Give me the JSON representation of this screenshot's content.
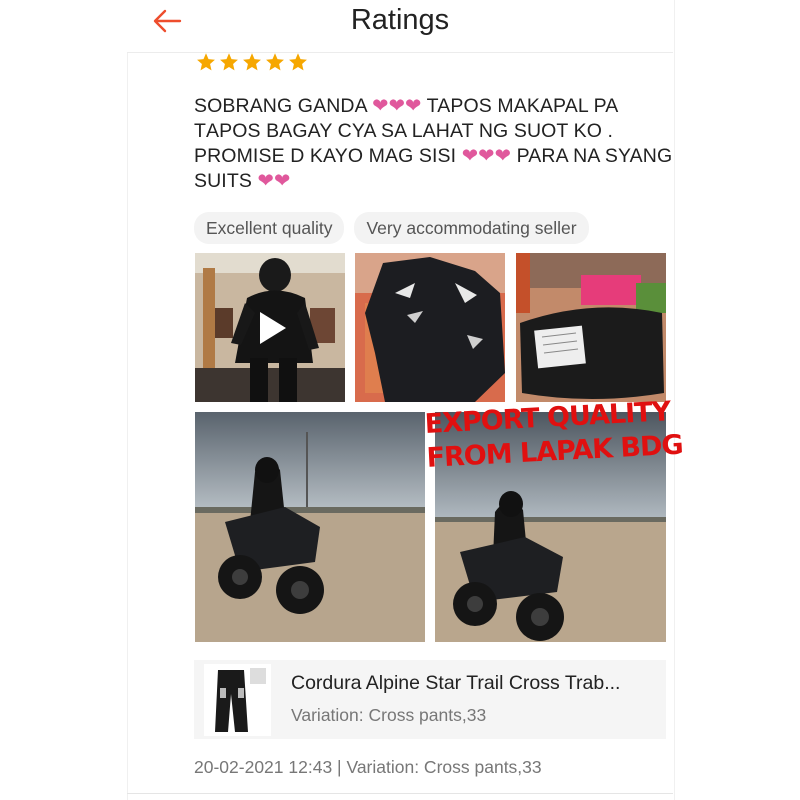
{
  "header": {
    "title": "Ratings",
    "back_icon": "arrow-left-icon",
    "accent": "#ee4d2d"
  },
  "rating": {
    "stars": 5,
    "star_color": "#f6a700"
  },
  "review": {
    "text": "SOBRANG GANDA ❤❤❤ TAPOS MAKAPAL PA TAPOS BAGAY CYA SA LAHAT NG SUOT KO . PROMISE D KAYO MAG SISI ❤❤❤ PARA NA SYANG SUITS ❤❤",
    "heart_color": "#e0589c"
  },
  "tags": [
    "Excellent quality",
    "Very accommodating seller"
  ],
  "media": {
    "video_icon": "play-icon",
    "overlay_text_line1": "EXPORT QUALITY",
    "overlay_text_line2": "FROM LAPAK BDG"
  },
  "product": {
    "name": "Cordura Alpine Star Trail Cross Trab...",
    "variation": "Variation: Cross pants,33"
  },
  "footer": {
    "meta": "20-02-2021 12:43 | Variation: Cross pants,33"
  }
}
